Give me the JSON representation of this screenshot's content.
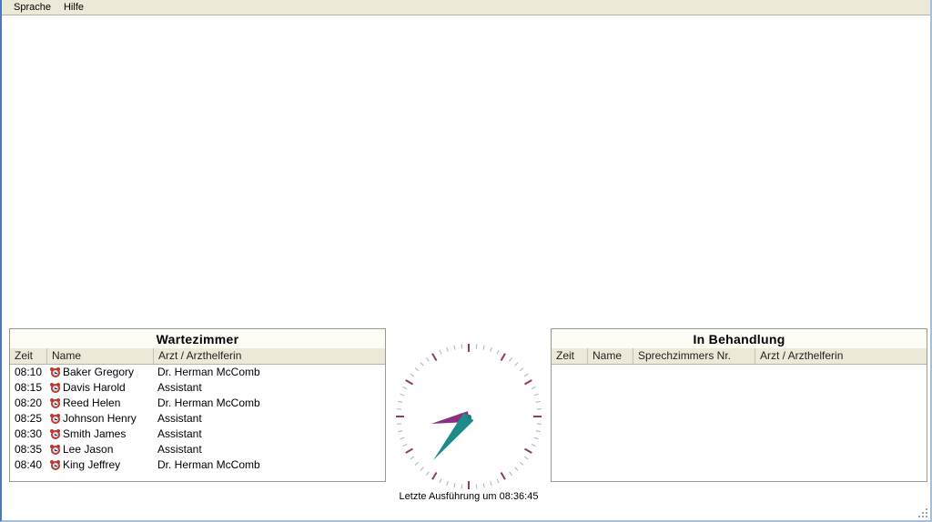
{
  "window": {
    "frame_color": "#4a79b8",
    "background": "#ffffff"
  },
  "menubar": {
    "items": [
      {
        "label": "Sprache",
        "name": "menu-sprache"
      },
      {
        "label": "Hilfe",
        "name": "menu-hilfe"
      }
    ]
  },
  "waiting_room": {
    "title": "Wartezimmer",
    "columns": [
      "Zeit",
      "Name",
      "Arzt / Arzthelferin"
    ],
    "rows": [
      {
        "time": "08:10",
        "name": "Baker Gregory",
        "doctor": "Dr. Herman McComb",
        "icon": "alarm-clock-icon"
      },
      {
        "time": "08:15",
        "name": "Davis Harold",
        "doctor": "Assistant",
        "icon": "alarm-clock-icon"
      },
      {
        "time": "08:20",
        "name": "Reed Helen",
        "doctor": "Dr. Herman McComb",
        "icon": "alarm-clock-icon"
      },
      {
        "time": "08:25",
        "name": "Johnson Henry",
        "doctor": "Assistant",
        "icon": "alarm-clock-icon"
      },
      {
        "time": "08:30",
        "name": "Smith James",
        "doctor": "Assistant",
        "icon": "alarm-clock-icon"
      },
      {
        "time": "08:35",
        "name": "Lee Jason",
        "doctor": "Assistant",
        "icon": "alarm-clock-icon"
      },
      {
        "time": "08:40",
        "name": "King Jeffrey",
        "doctor": "Dr. Herman McComb",
        "icon": "alarm-clock-icon"
      }
    ]
  },
  "in_treatment": {
    "title": "In Behandlung",
    "columns": [
      "Zeit",
      "Name",
      "Sprechzimmers Nr.",
      "Arzt / Arzthelferin"
    ],
    "rows": []
  },
  "clock": {
    "caption": "Letzte Ausführung um 08:36:45",
    "time": "08:36:45",
    "hour_hand_angle_deg": 259,
    "minute_hand_angle_deg": 219,
    "major_tick_color": "#8e3a6b",
    "minor_tick_color": "#9fb4c4",
    "hour_hand_color": "#8e2e7e",
    "minute_hand_color": "#1f8a8a",
    "tick_count": 60,
    "major_tick_every": 5
  },
  "resize_grip": {
    "name": "resize-grip"
  }
}
